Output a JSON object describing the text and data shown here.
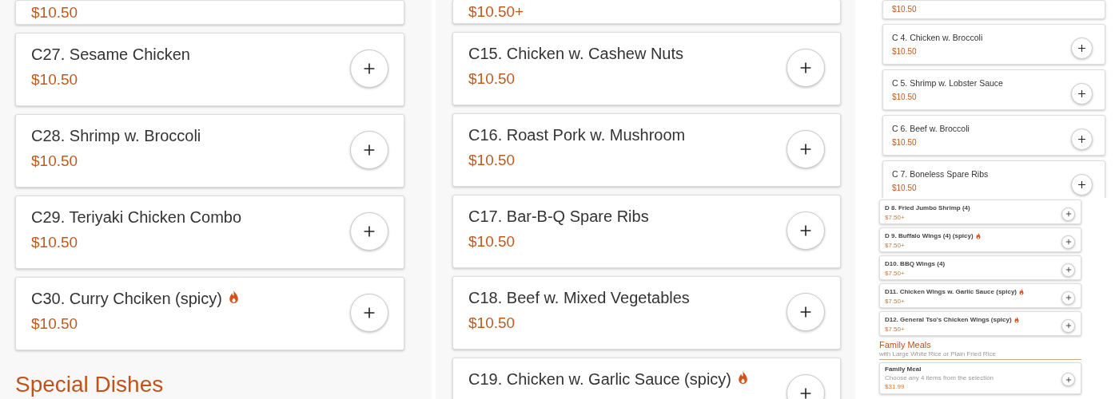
{
  "left_panel": {
    "items": [
      {
        "price": "$10.50",
        "spicy": false
      },
      {
        "name": "C27. Sesame Chicken",
        "price": "$10.50",
        "spicy": false
      },
      {
        "name": "C28. Shrimp w. Broccoli",
        "price": "$10.50",
        "spicy": false
      },
      {
        "name": "C29. Teriyaki Chicken Combo",
        "price": "$10.50",
        "spicy": false
      },
      {
        "name": "C30. Curry Chciken (spicy)",
        "price": "$10.50",
        "spicy": true
      }
    ],
    "next_section": {
      "title": "Special Dishes"
    }
  },
  "middle_panel": {
    "items": [
      {
        "price": "$10.50+",
        "spicy": false
      },
      {
        "name": "C15. Chicken w. Cashew Nuts",
        "price": "$10.50",
        "spicy": false
      },
      {
        "name": "C16. Roast Pork w. Mushroom",
        "price": "$10.50",
        "spicy": false
      },
      {
        "name": "C17. Bar-B-Q Spare Ribs",
        "price": "$10.50",
        "spicy": false
      },
      {
        "name": "C18. Beef w. Mixed Vegetables",
        "price": "$10.50",
        "spicy": false
      },
      {
        "name": "C19. Chicken w. Garlic Sauce (spicy)",
        "spicy": true
      }
    ]
  },
  "right_top_panel": {
    "items": [
      {
        "price": "$10.50",
        "spicy": false
      },
      {
        "name": "C 4. Chicken w. Broccoli",
        "price": "$10.50",
        "spicy": false
      },
      {
        "name": "C 5. Shrimp w. Lobster Sauce",
        "price": "$10.50",
        "spicy": false
      },
      {
        "name": "C 6. Beef w. Broccoli",
        "price": "$10.50",
        "spicy": false
      },
      {
        "name": "C 7. Boneless Spare Ribs",
        "price": "$10.50",
        "spicy": false
      }
    ]
  },
  "right_bottom_panel": {
    "items": [
      {
        "name": "D 8. Fried Jumbo Shrimp (4)",
        "price": "$7.50+",
        "spicy": false
      },
      {
        "name": "D 9. Buffalo Wings (4) (spicy)",
        "price": "$7.50+",
        "spicy": true
      },
      {
        "name": "D10. BBQ Wings (4)",
        "price": "$7.50+",
        "spicy": false
      },
      {
        "name": "D11. Chicken Wings w. Garlic Sauce (spicy)",
        "price": "$7.50+",
        "spicy": true
      },
      {
        "name": "D12. General Tso's Chicken Wings (spicy)",
        "price": "$7.50+",
        "spicy": true
      }
    ],
    "section": {
      "title": "Family Meals",
      "subtitle": "with Large White Rice or Plain Fried Rice",
      "items": [
        {
          "name": "Family Meal",
          "description": "Choose any 4 items from the selection",
          "price": "$31.99",
          "spicy": false
        }
      ]
    }
  }
}
